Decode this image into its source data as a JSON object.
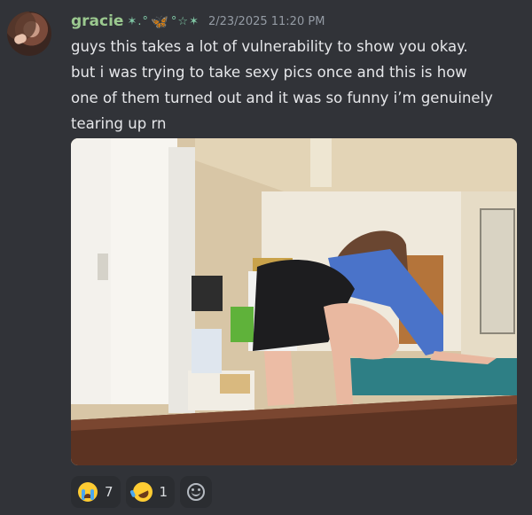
{
  "message": {
    "username": "gracie",
    "username_color": "#9bc98f",
    "decor_left": "✶.°",
    "decor_right": "°☆✶",
    "butterfly_icon": "butterfly-icon",
    "timestamp": "2/23/2025 11:20 PM",
    "text_lines": [
      "guys this takes a lot of vulnerability to show you okay.",
      "but i was trying to take sexy pics once and this is how",
      "one of them turned out and it was so funny i’m genuinely",
      "tearing up rn"
    ],
    "attachment_icon": "photo"
  },
  "reactions": [
    {
      "emoji": "loudly-crying-face",
      "count": "7"
    },
    {
      "emoji": "rolling-on-floor-laughing",
      "count": "1"
    }
  ],
  "add_reaction_icon": "add-reaction-icon",
  "colors": {
    "background": "#313338",
    "reaction_bg": "#2b2d31",
    "timestamp": "#949ba4"
  }
}
